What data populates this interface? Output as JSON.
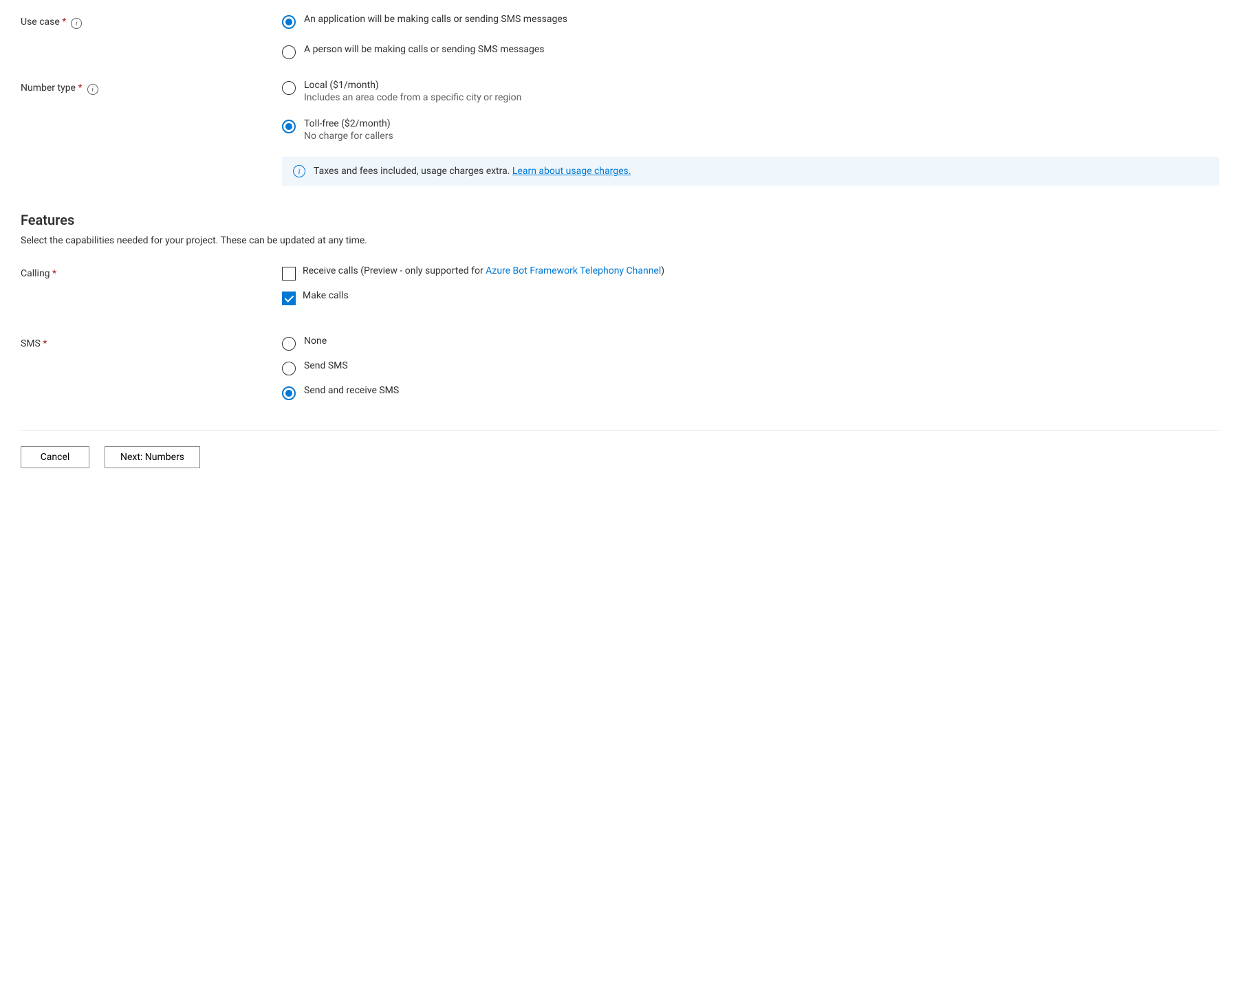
{
  "useCase": {
    "label": "Use case",
    "options": {
      "app": "An application will be making calls or sending SMS messages",
      "person": "A person will be making calls or sending SMS messages"
    }
  },
  "numberType": {
    "label": "Number type",
    "local": {
      "label": "Local ($1/month)",
      "sub": "Includes an area code from a specific city or region"
    },
    "tollFree": {
      "label": "Toll-free ($2/month)",
      "sub": "No charge for callers"
    }
  },
  "banner": {
    "text": "Taxes and fees included, usage charges extra. ",
    "linkText": "Learn about usage charges."
  },
  "features": {
    "heading": "Features",
    "desc": "Select the capabilities needed for your project. These can be updated at any time."
  },
  "calling": {
    "label": "Calling",
    "receive": {
      "prefix": "Receive calls (Preview - only supported for ",
      "link": "Azure Bot Framework Telephony Channel",
      "suffix": ")"
    },
    "make": "Make calls"
  },
  "sms": {
    "label": "SMS",
    "none": "None",
    "send": "Send SMS",
    "sendReceive": "Send and receive SMS"
  },
  "buttons": {
    "cancel": "Cancel",
    "next": "Next: Numbers"
  }
}
